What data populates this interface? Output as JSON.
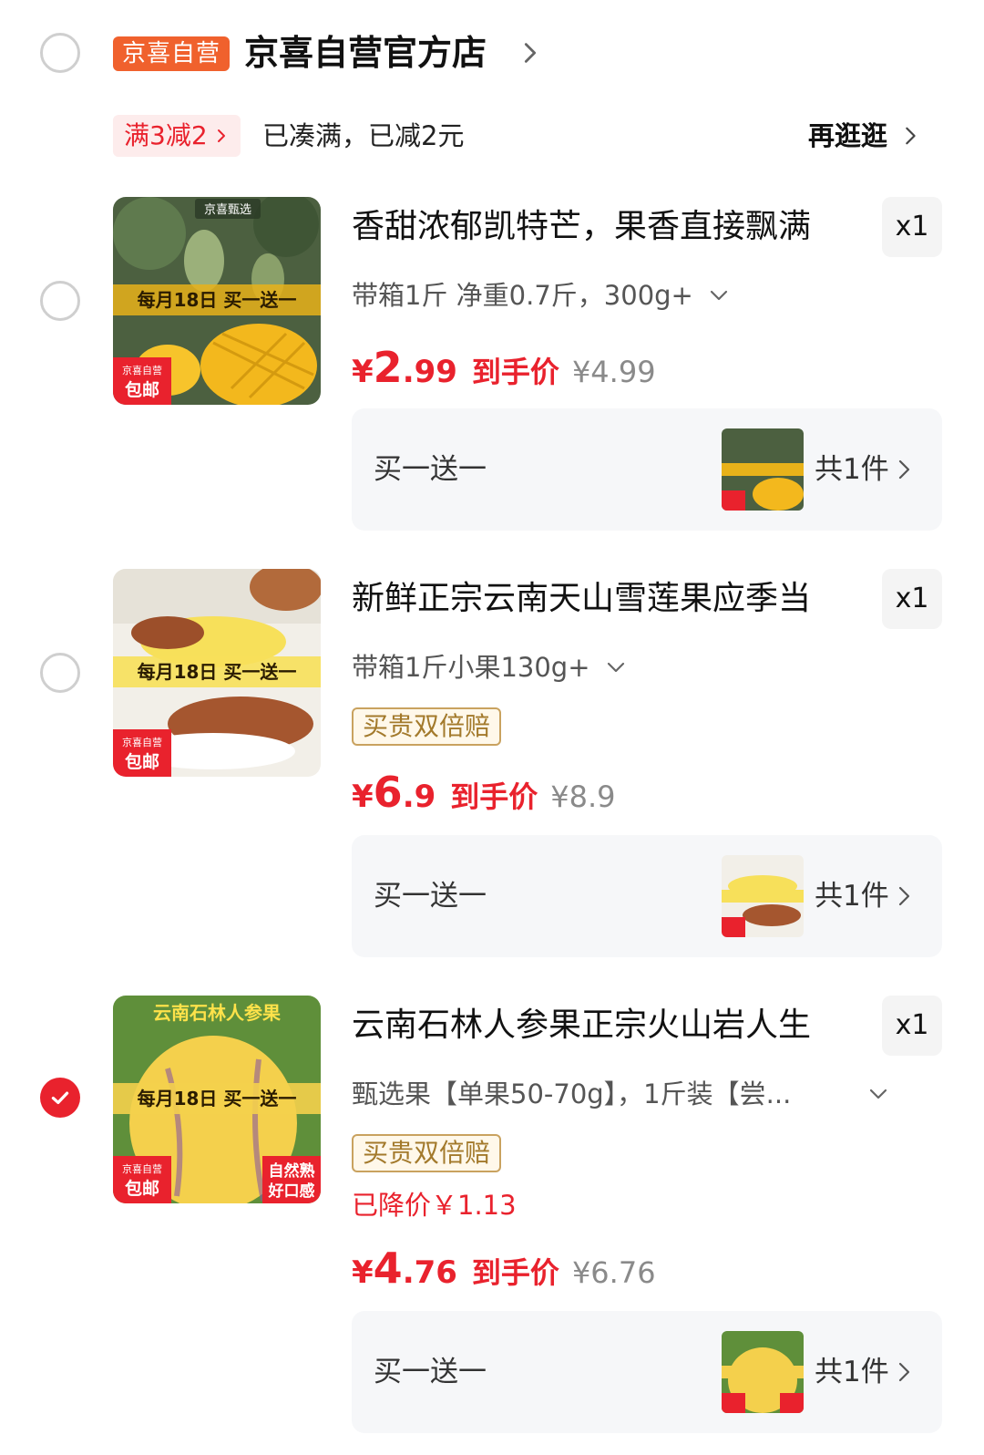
{
  "shop": {
    "tag": "京喜自营",
    "name": "京喜自营官方店"
  },
  "promo": {
    "badge": "满3减2",
    "text": "已凑满，已减2元",
    "browse": "再逛逛"
  },
  "items": [
    {
      "title": "香甜浓郁凯特芒，果香直接飘满",
      "qty": "x1",
      "spec": "带箱1斤 净重0.7斤，300g+",
      "price_symbol": "¥",
      "price_int": "2",
      "price_dec": ".99",
      "price_label": "到手价",
      "orig_price": "¥4.99",
      "gift_label": "买一送一",
      "gift_count": "共1件",
      "selected": false,
      "thumb": {
        "top_text": "京喜甄选",
        "banner": "每月18日 买一送一",
        "corner_top": "京喜自营",
        "corner_bottom": "包邮"
      }
    },
    {
      "title": "新鲜正宗云南天山雪莲果应季当",
      "qty": "x1",
      "spec": "带箱1斤小果130g+",
      "badge": "买贵双倍赔",
      "price_symbol": "¥",
      "price_int": "6",
      "price_dec": ".9",
      "price_label": "到手价",
      "orig_price": "¥8.9",
      "gift_label": "买一送一",
      "gift_count": "共1件",
      "selected": false,
      "thumb": {
        "banner": "每月18日 买一送一",
        "corner_top": "京喜自营",
        "corner_bottom": "包邮"
      }
    },
    {
      "title": "云南石林人参果正宗火山岩人生",
      "qty": "x1",
      "spec": "甄选果【单果50-70g】，1斤装【尝...",
      "badge": "买贵双倍赔",
      "price_drop": "已降价￥1.13",
      "price_symbol": "¥",
      "price_int": "4",
      "price_dec": ".76",
      "price_label": "到手价",
      "orig_price": "¥6.76",
      "gift_label": "买一送一",
      "gift_count": "共1件",
      "selected": true,
      "thumb": {
        "top_text": "云南石林人参果",
        "banner": "每月18日 买一送一",
        "corner_top": "京喜自营",
        "corner_bottom": "包邮",
        "corner_right_top": "自然熟",
        "corner_right_bottom": "好口感"
      }
    }
  ],
  "colors": {
    "accent": "#e9222d",
    "shop_tag": "#f0612d",
    "gold": "#c9a25f"
  }
}
